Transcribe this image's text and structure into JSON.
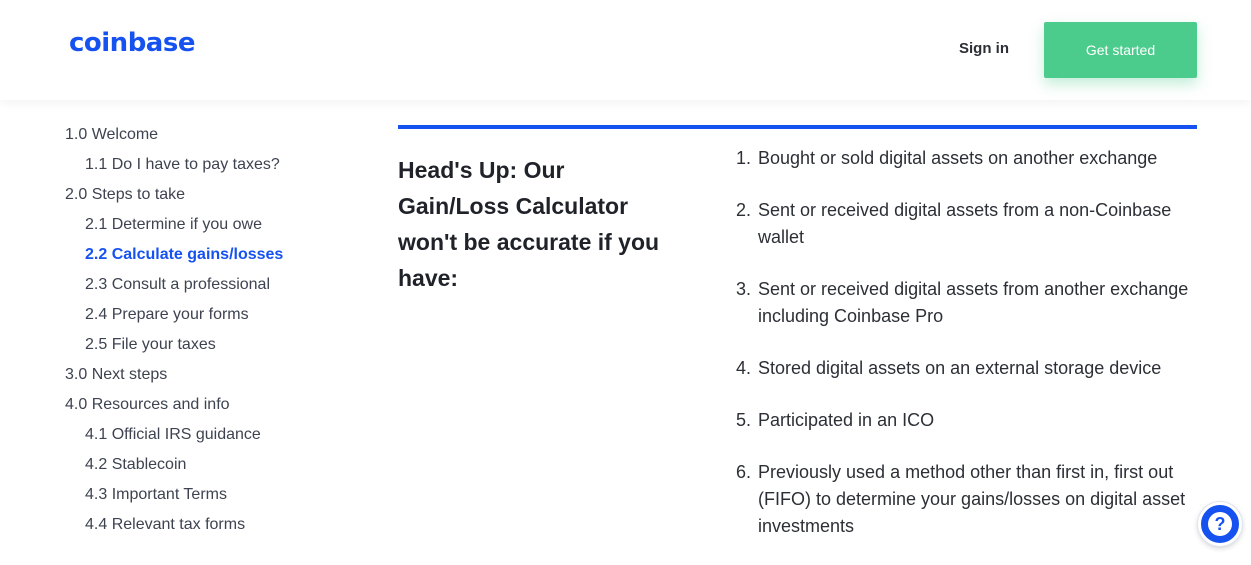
{
  "header": {
    "logo": "coinbase",
    "sign_in": "Sign in",
    "get_started": "Get started"
  },
  "toc": {
    "items": [
      {
        "label": "1.0 Welcome",
        "level": 1,
        "active": false
      },
      {
        "label": "1.1 Do I have to pay taxes?",
        "level": 2,
        "active": false
      },
      {
        "label": "2.0 Steps to take",
        "level": 1,
        "active": false
      },
      {
        "label": "2.1 Determine if you owe",
        "level": 2,
        "active": false
      },
      {
        "label": "2.2 Calculate gains/losses",
        "level": 2,
        "active": true
      },
      {
        "label": "2.3 Consult a professional",
        "level": 2,
        "active": false
      },
      {
        "label": "2.4 Prepare your forms",
        "level": 2,
        "active": false
      },
      {
        "label": "2.5 File your taxes",
        "level": 2,
        "active": false
      },
      {
        "label": "3.0 Next steps",
        "level": 1,
        "active": false
      },
      {
        "label": "4.0 Resources and info",
        "level": 1,
        "active": false
      },
      {
        "label": "4.1 Official IRS guidance",
        "level": 2,
        "active": false
      },
      {
        "label": "4.2 Stablecoin",
        "level": 2,
        "active": false
      },
      {
        "label": "4.3 Important Terms",
        "level": 2,
        "active": false
      },
      {
        "label": "4.4 Relevant tax forms",
        "level": 2,
        "active": false
      }
    ]
  },
  "main": {
    "heading": "Head's Up: Our Gain/Loss Calculator won't be accurate if you have:",
    "list": [
      {
        "num": "1.",
        "text": "Bought or sold digital assets on another exchange"
      },
      {
        "num": "2.",
        "text": "Sent or received digital assets from a non-Coinbase wallet"
      },
      {
        "num": "3.",
        "text": "Sent or received digital assets from another exchange including Coinbase Pro"
      },
      {
        "num": "4.",
        "text": "Stored digital assets on an external storage device"
      },
      {
        "num": "5.",
        "text": "Participated in an ICO"
      },
      {
        "num": "6.",
        "text": "Previously used a method other than first in, first out (FIFO) to determine your gains/losses on digital asset investments"
      }
    ]
  },
  "help": {
    "icon": "question-icon",
    "glyph": "?"
  },
  "colors": {
    "brand": "#1652f0",
    "cta": "#4ccc8c"
  }
}
